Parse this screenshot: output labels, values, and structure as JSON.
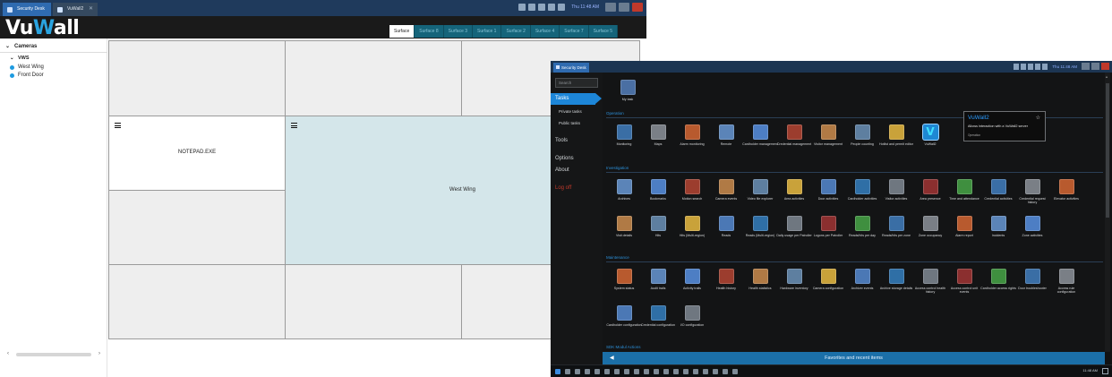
{
  "vuwall": {
    "tabs": [
      {
        "label": "Security Desk"
      },
      {
        "label": "VuWall2"
      }
    ],
    "tray_time": "Thu 11:48 AM",
    "logo_main": "Vu",
    "logo_accent": "W",
    "logo_rest": "all",
    "surfaces": [
      "Surface",
      "Surface 8",
      "Surface 3",
      "Surface 1",
      "Surface 2",
      "Surface 4",
      "Surface 7",
      "Surface 5"
    ],
    "sidebar": {
      "section": "Cameras",
      "group": "VWS",
      "items": [
        "West Wing",
        "Front Door"
      ]
    },
    "grid": {
      "notepad_label": "NOTEPAD.EXE",
      "west_label": "West Wing"
    }
  },
  "security_desk": {
    "tab_label": "Security Desk",
    "tray_time": "Thu 11:48 AM",
    "search_placeholder": "Search",
    "nav": {
      "tasks": "Tasks",
      "private_tasks": "Private tasks",
      "public_tasks": "Public tasks",
      "tools": "Tools",
      "options": "Options",
      "about": "About",
      "logoff": "Log off"
    },
    "my_task": "My task",
    "sections": {
      "operation": "Operation",
      "investigation": "Investigation",
      "maintenance": "Maintenance",
      "sdk": "SDK Modul Actions"
    },
    "operation_tasks": [
      "Monitoring",
      "Maps",
      "Alarm monitoring",
      "Remote",
      "Cardholder management",
      "Credential management",
      "Visitor management",
      "People counting",
      "Hotlist and permit editor",
      "VuWall2"
    ],
    "investigation_row1": [
      "Archives",
      "Bookmarks",
      "Motion search",
      "Camera events",
      "Video file explorer",
      "Area activities",
      "Door activities",
      "Cardholder activities",
      "Visitor activities",
      "Area presence",
      "Time and attendance",
      "Credential activities",
      "Credential request history",
      "Elevator activities"
    ],
    "investigation_row2": [
      "Visit details",
      "Hits",
      "Hits (Multi-region)",
      "Reads",
      "Reads (Multi-region)",
      "Daily usage per Patroller",
      "Logons per Patroller",
      "Reads/hits per day",
      "Reads/hits per zone",
      "Zone occupancy",
      "Alarm report",
      "Incidents",
      "Zone activities"
    ],
    "maintenance_row1": [
      "System status",
      "Audit trails",
      "Activity trails",
      "Health history",
      "Health statistics",
      "Hardware inventory",
      "Camera configuration",
      "Archiver events",
      "Archive storage details",
      "Access control health history",
      "Access control unit events",
      "Cardholder access rights",
      "Door troubleshooter",
      "Access rule configuration"
    ],
    "maintenance_row2": [
      "Cardholder configuration",
      "Credential configuration",
      "I/O configuration"
    ],
    "tooltip": {
      "title": "VuWall2",
      "description": "Allows interaction with a VuWall2 server",
      "category": "Operation"
    },
    "favorites": "Favorites and recent items",
    "taskbar_time": "11:48 AM",
    "colors": {
      "accent": "#1d86d8",
      "section_text": "#2c8fd8",
      "favorites_bar": "#1b6fa8",
      "logoff": "#c0392b"
    }
  }
}
